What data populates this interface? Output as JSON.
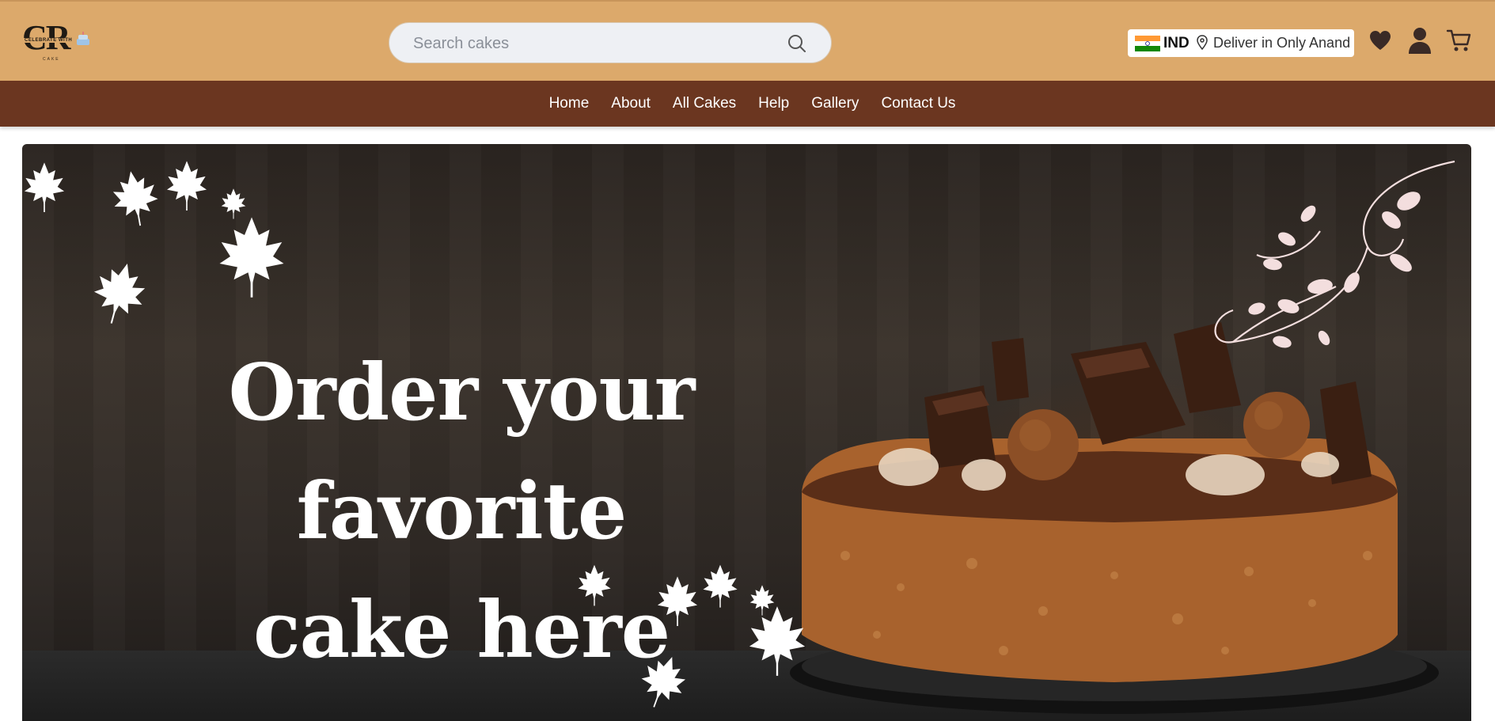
{
  "header": {
    "logo": {
      "mark": "CR",
      "tagline": "CELEBRATE WITH",
      "sub": "CAKE"
    },
    "search": {
      "placeholder": "Search cakes",
      "icon": "search-icon"
    },
    "location": {
      "country_code": "IND",
      "flag_icon": "india-flag-icon",
      "pin_icon": "location-pin-icon",
      "text": "Deliver in Only Anand"
    },
    "icons": [
      "heart-icon",
      "user-icon",
      "cart-icon"
    ]
  },
  "nav": {
    "items": [
      "Home",
      "About",
      "All Cakes",
      "Help",
      "Gallery",
      "Contact Us"
    ]
  },
  "hero": {
    "line1": "Order your favorite",
    "line2": "cake here",
    "decor": [
      "maple-leaf-icon",
      "floral-branch-icon",
      "chocolate-cake-image"
    ]
  },
  "colors": {
    "header_bg": "#dca96b",
    "nav_bg": "#6b3620",
    "text_light": "#ffffff"
  }
}
